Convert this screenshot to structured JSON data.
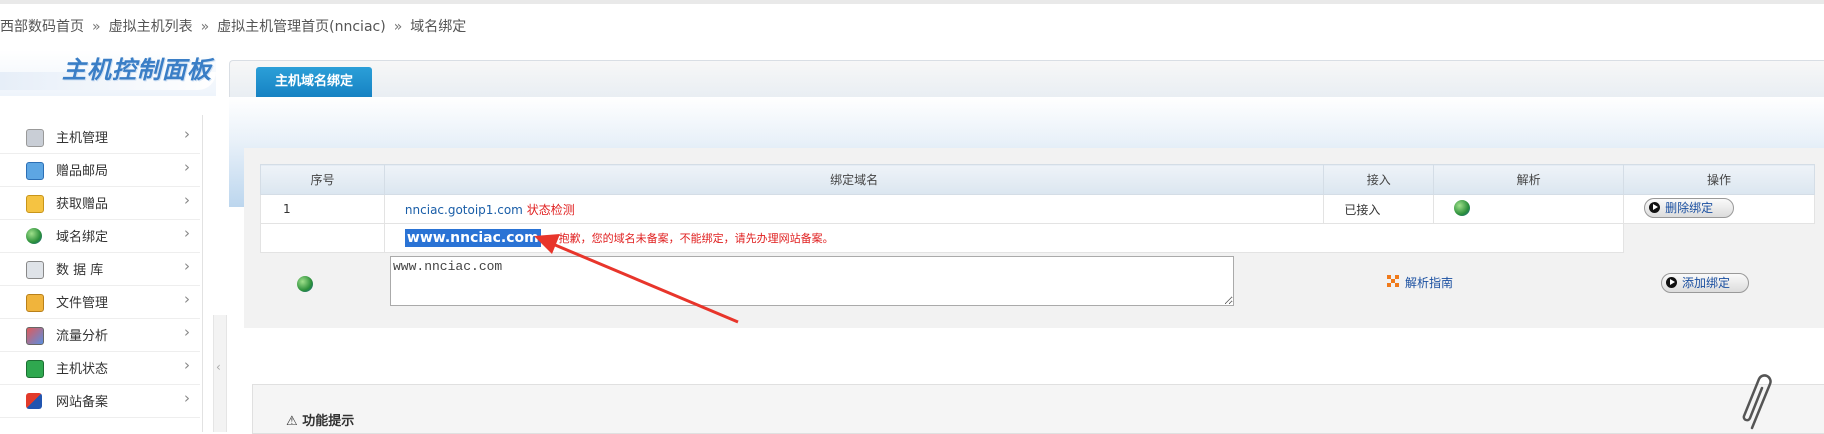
{
  "breadcrumb": {
    "items": [
      "西部数码首页",
      "虚拟主机列表",
      "虚拟主机管理首页(nnciac)",
      "域名绑定"
    ],
    "separator": "»"
  },
  "logo": {
    "title": "主机控制面板"
  },
  "sidebar": {
    "items": [
      {
        "label": "主机管理",
        "icon": "server-icon"
      },
      {
        "label": "赠品邮局",
        "icon": "mail-icon"
      },
      {
        "label": "获取赠品",
        "icon": "gift-icon"
      },
      {
        "label": "域名绑定",
        "icon": "globe-icon"
      },
      {
        "label": "数 据 库",
        "icon": "database-icon"
      },
      {
        "label": "文件管理",
        "icon": "folder-icon"
      },
      {
        "label": "流量分析",
        "icon": "chart-icon"
      },
      {
        "label": "主机状态",
        "icon": "status-icon"
      },
      {
        "label": "网站备案",
        "icon": "record-icon"
      }
    ],
    "chevron": "›"
  },
  "main": {
    "tab_label": "主机域名绑定",
    "table": {
      "headers": [
        "序号",
        "绑定域名",
        "接入",
        "解析",
        "操作"
      ],
      "rows": [
        {
          "index": "1",
          "domain": "nnciac.gotoip1.com",
          "status_check": "状态检测",
          "access": "已接入",
          "action": "删除绑定"
        }
      ],
      "pending": {
        "domain": "www.nnciac.com",
        "error": "抱歉，您的域名未备案，不能绑定，请先办理网站备案。"
      }
    },
    "add_form": {
      "textarea_value": "www.nnciac.com",
      "guide_label": "解析指南",
      "add_button": "添加绑定"
    },
    "tips_title": "功能提示"
  },
  "colors": {
    "accent": "#1682c3",
    "error": "#e02020",
    "link": "#1a5ea8",
    "arrow": "#e8352b"
  }
}
